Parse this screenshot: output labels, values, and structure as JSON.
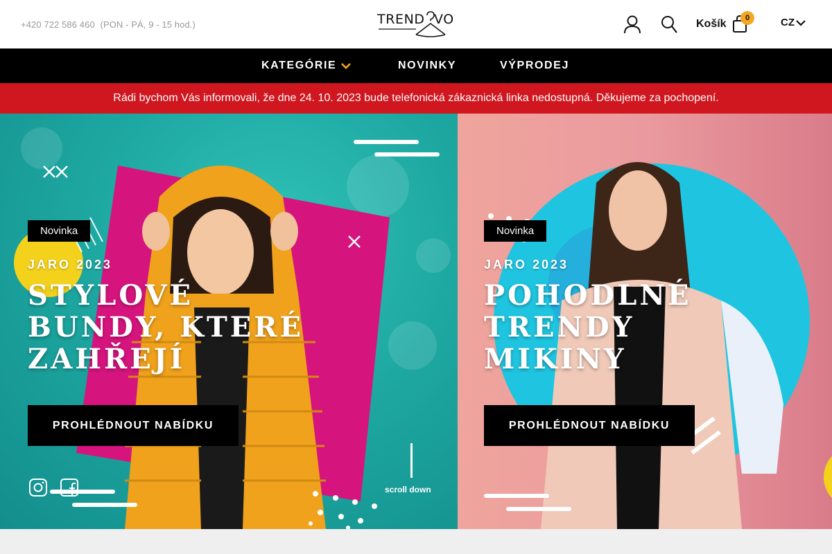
{
  "header": {
    "phone": "+420 722 586 460",
    "hours": "(PON - PÁ, 9 - 15 hod.)",
    "logo_text": "TREND VO",
    "cart_label": "Košík",
    "cart_count": "0",
    "language": "CZ"
  },
  "nav": {
    "items": [
      {
        "label": "KATEGÓRIE"
      },
      {
        "label": "NOVINKY"
      },
      {
        "label": "VÝPRODEJ"
      }
    ]
  },
  "notice": {
    "text": "Rádi bychom Vás informovali, že dne 24. 10. 2023 bude telefonická zákaznická linka nedostupná. Děkujeme za pochopení."
  },
  "slides": [
    {
      "badge": "Novinka",
      "season": "JARO 2023",
      "headline": "STYLOVÉ BUNDY, KTERÉ ZAHŘEJÍ",
      "cta": "PROHLÉDNOUT NABÍDKU"
    },
    {
      "badge": "Novinka",
      "season": "JARO 2023",
      "headline": "POHODLNÉ TRENDY MIKINY",
      "cta": "PROHLÉDNOUT NABÍDKU"
    }
  ],
  "scroll_label": "scroll down",
  "colors": {
    "accent_orange": "#f5a623",
    "notice_red": "#d0161e",
    "nav_bg": "#000000",
    "teal": "#1ea8a2",
    "pink": "#ea9a9e",
    "magenta": "#d6147e",
    "yellow": "#f4d21c",
    "cyan": "#1fc5e0"
  }
}
